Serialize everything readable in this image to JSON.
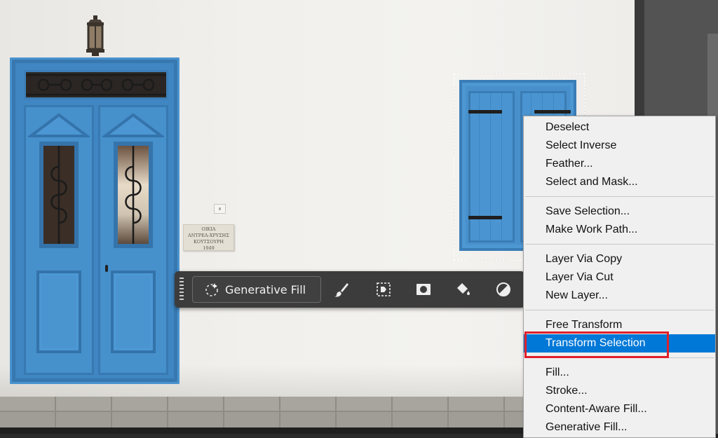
{
  "canvas": {
    "label": "Document canvas"
  },
  "plaque": {
    "lines": [
      "ΟΙΚΙΑ",
      "ΑΝΤΡΕΑ-ΧΡΥΣΗΣ",
      "ΚΟΥΤΣΟΥΡΗ",
      "1949"
    ]
  },
  "taskbar": {
    "generative_fill_label": "Generative Fill",
    "icons": [
      "brush-icon",
      "select-subject-icon",
      "mask-icon",
      "fill-bucket-icon",
      "adjustment-icon"
    ]
  },
  "context_menu": {
    "groups": [
      [
        "Deselect",
        "Select Inverse",
        "Feather...",
        "Select and Mask..."
      ],
      [
        "Save Selection...",
        "Make Work Path..."
      ],
      [
        "Layer Via Copy",
        "Layer Via Cut",
        "New Layer..."
      ],
      [
        "Free Transform",
        "Transform Selection"
      ],
      [
        "Fill...",
        "Stroke...",
        "Content-Aware Fill...",
        "Generative Fill..."
      ]
    ],
    "highlighted_item": "Transform Selection"
  },
  "colors": {
    "menu_highlight": "#0078d7",
    "callout_border": "#e0202a",
    "door_blue": "#4690cb"
  }
}
